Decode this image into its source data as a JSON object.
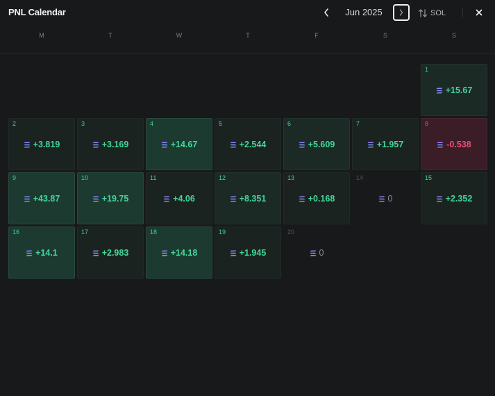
{
  "header": {
    "title": "PNL Calendar",
    "month": "Jun 2025",
    "currency": "SOL"
  },
  "weekdays": [
    "M",
    "T",
    "W",
    "T",
    "F",
    "S",
    "S"
  ],
  "colors": {
    "gain_text": "#42d69c",
    "loss_text": "#ee4d74",
    "gain_strong_bg": "#1d3a30",
    "gain_bg": "#1c2a26",
    "gain_weak_bg": "#1b2320",
    "loss_bg": "#3a1d27",
    "page_bg": "#18191b"
  },
  "days": [
    {
      "day": "1",
      "value": "+15.67"
    },
    {
      "day": "2",
      "value": "+3.819"
    },
    {
      "day": "3",
      "value": "+3.169"
    },
    {
      "day": "4",
      "value": "+14.67"
    },
    {
      "day": "5",
      "value": "+2.544"
    },
    {
      "day": "6",
      "value": "+5.609"
    },
    {
      "day": "7",
      "value": "+1.957"
    },
    {
      "day": "8",
      "value": "-0.538"
    },
    {
      "day": "9",
      "value": "+43.87"
    },
    {
      "day": "10",
      "value": "+19.75"
    },
    {
      "day": "11",
      "value": "+4.06"
    },
    {
      "day": "12",
      "value": "+8.351"
    },
    {
      "day": "13",
      "value": "+0.168"
    },
    {
      "day": "14",
      "value": "0"
    },
    {
      "day": "15",
      "value": "+2.352"
    },
    {
      "day": "16",
      "value": "+14.1"
    },
    {
      "day": "17",
      "value": "+2.983"
    },
    {
      "day": "18",
      "value": "+14.18"
    },
    {
      "day": "19",
      "value": "+1.945"
    },
    {
      "day": "20",
      "value": "0"
    }
  ]
}
